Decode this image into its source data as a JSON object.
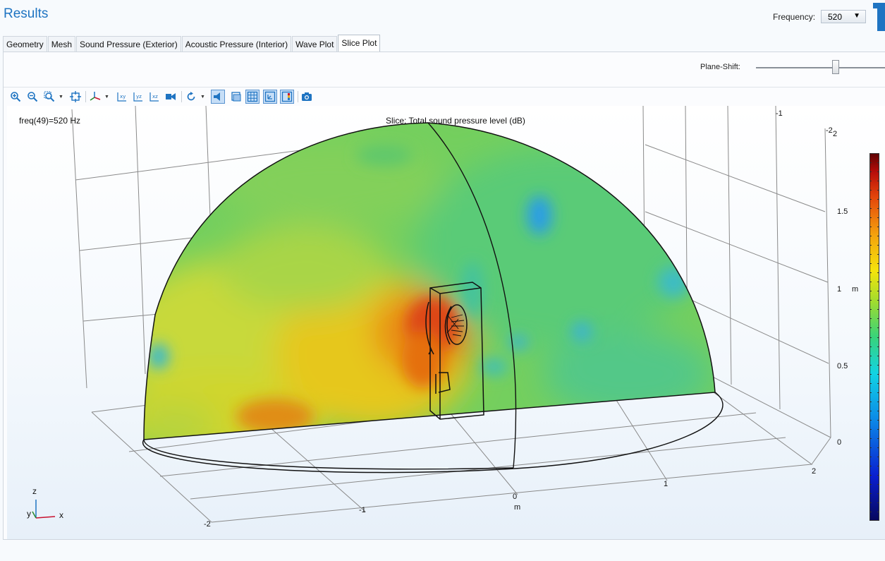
{
  "header": {
    "title": "Results",
    "frequency_label": "Frequency:",
    "frequency_value": "520"
  },
  "tabs": [
    {
      "label": "Geometry"
    },
    {
      "label": "Mesh"
    },
    {
      "label": "Sound Pressure (Exterior)"
    },
    {
      "label": "Acoustic Pressure (Interior)"
    },
    {
      "label": "Wave Plot"
    },
    {
      "label": "Slice Plot",
      "active": true
    }
  ],
  "controls": {
    "plane_shift_label": "Plane-Shift:",
    "plane_shift_fraction": 0.62
  },
  "toolbar": {
    "buttons": [
      {
        "name": "zoom-in-button",
        "icon": "zoom-in-icon",
        "active": false
      },
      {
        "name": "zoom-out-button",
        "icon": "zoom-out-icon",
        "active": false
      },
      {
        "name": "zoom-box-button",
        "icon": "zoom-box-icon",
        "active": false
      },
      {
        "name": "zoom-extents-button",
        "icon": "zoom-extents-icon",
        "active": false
      },
      {
        "name": "go-to-default-view-button",
        "icon": "axes-view-icon",
        "active": false
      },
      {
        "name": "xy-view-button",
        "icon": "xy-plane-icon",
        "active": false
      },
      {
        "name": "yz-view-button",
        "icon": "yz-plane-icon",
        "active": false
      },
      {
        "name": "xz-view-button",
        "icon": "xz-plane-icon",
        "active": false
      },
      {
        "name": "camera-projection-button",
        "icon": "camera-icon",
        "active": false
      },
      {
        "name": "rotate-button",
        "icon": "rotate-icon",
        "active": false
      },
      {
        "name": "scene-light-button",
        "icon": "speaker-icon",
        "active": true
      },
      {
        "name": "transparency-button",
        "icon": "transparency-icon",
        "active": false
      },
      {
        "name": "show-grid-button",
        "icon": "grid-icon",
        "active": true
      },
      {
        "name": "show-axis-button",
        "icon": "axis-orientation-icon",
        "active": true
      },
      {
        "name": "show-legends-button",
        "icon": "legend-icon",
        "active": true
      },
      {
        "name": "image-snapshot-button",
        "icon": "snapshot-camera-icon",
        "active": false
      }
    ]
  },
  "plot": {
    "freq_text": "freq(49)=520 Hz",
    "slice_title": "Slice: Total sound pressure level (dB)",
    "z_ticks": [
      "2",
      "1.5",
      "1",
      "0.5",
      "0"
    ],
    "z_unit": "m",
    "x_ticks": [
      "-2",
      "-1",
      "0",
      "1",
      "2"
    ],
    "x_unit": "m",
    "y_ticks": [
      "-1",
      "-2"
    ],
    "triad": {
      "z": "z",
      "y": "y",
      "x": "x"
    },
    "colors": {
      "accent": "#1f74c2",
      "active_button": "#c6def7"
    }
  }
}
